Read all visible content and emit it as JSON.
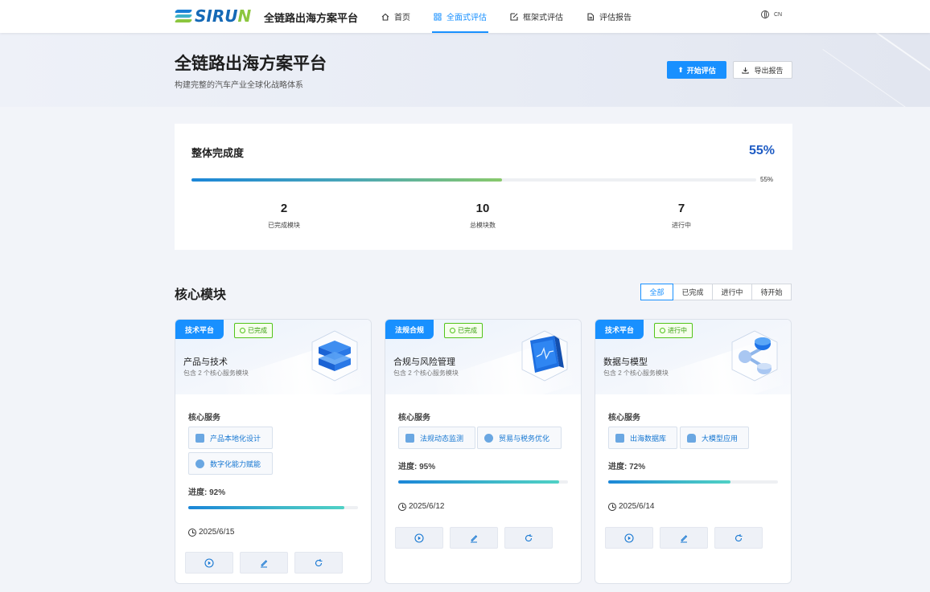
{
  "header": {
    "logo_text_main": "SIRU",
    "logo_text_accent": "N",
    "app_title": "全链路出海方案平台",
    "nav": [
      {
        "label": "首页",
        "icon": "home-icon"
      },
      {
        "label": "全面式评估",
        "icon": "grid-icon",
        "active": true
      },
      {
        "label": "框架式评估",
        "icon": "edit-icon"
      },
      {
        "label": "评估报告",
        "icon": "document-icon"
      }
    ],
    "lang": "CN"
  },
  "hero": {
    "title": "全链路出海方案平台",
    "subtitle": "构建完整的汽车产业全球化战略体系",
    "start_button": "开始评估",
    "export_button": "导出报告"
  },
  "overall": {
    "label": "整体完成度",
    "percent_text": "55%",
    "percent_value": 55,
    "bar_text": "55%",
    "stats": [
      {
        "value": "2",
        "label": "已完成模块"
      },
      {
        "value": "10",
        "label": "总模块数"
      },
      {
        "value": "7",
        "label": "进行中"
      }
    ]
  },
  "modules_section": {
    "title": "核心模块",
    "filters": [
      "全部",
      "已完成",
      "进行中",
      "待开始"
    ],
    "active_filter": 0
  },
  "cards": [
    {
      "tag": "技术平台",
      "status": "已完成",
      "status_kind": "done",
      "name": "产品与技术",
      "desc": "包含 2 个核心服务模块",
      "core_label": "核心服务",
      "services": [
        "产品本地化设计",
        "数字化能力赋能"
      ],
      "progress_text": "进度: 92%",
      "progress": 92,
      "date": "2025/6/15"
    },
    {
      "tag": "法规合规",
      "status": "已完成",
      "status_kind": "done",
      "name": "合规与风险管理",
      "desc": "包含 2 个核心服务模块",
      "core_label": "核心服务",
      "services": [
        "法规动态监测",
        "贸易与税务优化"
      ],
      "progress_text": "进度: 95%",
      "progress": 95,
      "date": "2025/6/12"
    },
    {
      "tag": "技术平台",
      "status": "进行中",
      "status_kind": "progress",
      "name": "数据与模型",
      "desc": "包含 2 个核心服务模块",
      "core_label": "核心服务",
      "services": [
        "出海数据库",
        "大模型应用"
      ],
      "progress_text": "进度: 72%",
      "progress": 72,
      "date": "2025/6/14"
    }
  ]
}
